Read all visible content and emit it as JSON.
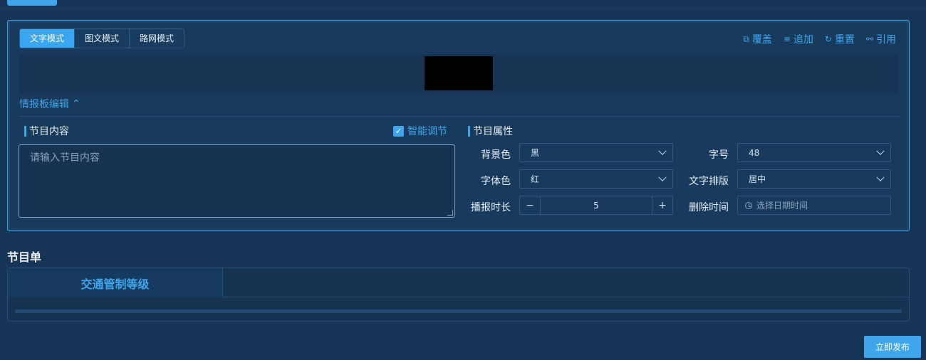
{
  "modes": [
    "文字模式",
    "图文模式",
    "路网模式"
  ],
  "active_mode": 0,
  "actions": [
    {
      "icon": "cover-icon",
      "glyph": "⧉",
      "label": "覆盖"
    },
    {
      "icon": "append-icon",
      "glyph": "≡",
      "label": "追加"
    },
    {
      "icon": "reset-icon",
      "glyph": "↻",
      "label": "重置"
    },
    {
      "icon": "link-icon",
      "glyph": "⚯",
      "label": "引用"
    }
  ],
  "board_edit": {
    "label": "情报板编辑",
    "icon_glyph": "⌃"
  },
  "content": {
    "title": "节目内容",
    "smart_label": "智能调节",
    "smart_checked": true,
    "placeholder": "请输入节目内容"
  },
  "props": {
    "title": "节目属性",
    "bg_color_label": "背景色",
    "bg_color_value": "黑",
    "font_size_label": "字号",
    "font_size_value": "48",
    "font_color_label": "字体色",
    "font_color_value": "红",
    "layout_label": "文字排版",
    "layout_value": "居中",
    "duration_label": "播报时长",
    "duration_value": "5",
    "delete_time_label": "删除时间",
    "delete_time_placeholder": "选择日期时间"
  },
  "program_list": {
    "title": "节目单",
    "tab_label": "交通管制等级"
  },
  "publish_label": "立即发布",
  "colors": {
    "accent": "#3fa6ec",
    "background": "#173556",
    "panel": "#183a5c"
  }
}
